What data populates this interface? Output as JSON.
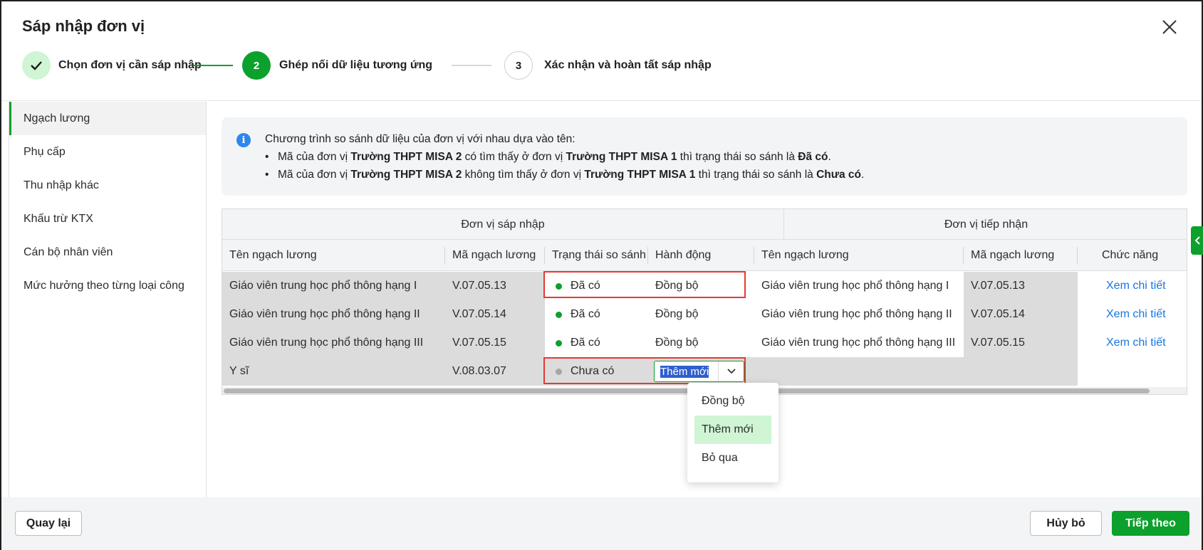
{
  "dialog": {
    "title": "Sáp nhập đơn vị"
  },
  "steps": [
    {
      "number": "",
      "label": "Chọn đơn vị cần sáp nhập",
      "state": "done"
    },
    {
      "number": "2",
      "label": "Ghép nối dữ liệu tương ứng",
      "state": "active"
    },
    {
      "number": "3",
      "label": "Xác nhận và hoàn tất sáp nhập",
      "state": "pending"
    }
  ],
  "sidebar": {
    "items": [
      {
        "label": "Ngạch lương",
        "active": true
      },
      {
        "label": "Phụ cấp"
      },
      {
        "label": "Thu nhập khác"
      },
      {
        "label": "Khấu trừ KTX"
      },
      {
        "label": "Cán bộ nhân viên"
      },
      {
        "label": "Mức hưởng theo từng loại công"
      }
    ]
  },
  "info": {
    "intro": "Chương trình so sánh dữ liệu của đơn vị với nhau dựa vào tên:",
    "line1": {
      "a": "Mã của đơn vị ",
      "b": "Trường THPT MISA 2",
      "c": " có tìm thấy ở đơn vị ",
      "d": "Trường THPT MISA 1",
      "e": " thì trạng thái so sánh là ",
      "f": "Đã có",
      "g": "."
    },
    "line2": {
      "a": "Mã của đơn vị ",
      "b": "Trường THPT MISA 2",
      "c": " không tìm thấy ở đơn vị ",
      "d": "Trường THPT MISA 1",
      "e": " thì trạng thái so sánh là ",
      "f": "Chưa có",
      "g": "."
    }
  },
  "table": {
    "group_left": "Đơn vị sáp nhập",
    "group_right": "Đơn vị tiếp nhận",
    "columns": {
      "src_name": "Tên ngạch lương",
      "src_code": "Mã ngạch lương",
      "status": "Trạng thái so sánh",
      "action": "Hành động",
      "dst_name": "Tên ngạch lương",
      "dst_code": "Mã ngạch lương",
      "func": "Chức năng"
    },
    "rows": [
      {
        "src_name": "Giáo viên trung học phổ thông hạng I",
        "src_code": "V.07.05.13",
        "status": "Đã có",
        "action": "Đồng bộ",
        "dst_name": "Giáo viên trung học phổ thông hạng I",
        "dst_code": "V.07.05.13",
        "func": "Xem chi tiết"
      },
      {
        "src_name": "Giáo viên trung học phổ thông hạng II",
        "src_code": "V.07.05.14",
        "status": "Đã có",
        "action": "Đồng bộ",
        "dst_name": "Giáo viên trung học phổ thông hạng II",
        "dst_code": "V.07.05.14",
        "func": "Xem chi tiết"
      },
      {
        "src_name": "Giáo viên trung học phổ thông hạng III",
        "src_code": "V.07.05.15",
        "status": "Đã có",
        "action": "Đồng bộ",
        "dst_name": "Giáo viên trung học phổ thông hạng III",
        "dst_code": "V.07.05.15",
        "func": "Xem chi tiết"
      },
      {
        "src_name": "Y sĩ",
        "src_code": "V.08.03.07",
        "status": "Chưa có",
        "action": "Thêm mới",
        "dst_name": "",
        "dst_code": "",
        "func": ""
      }
    ]
  },
  "dropdown": {
    "options": [
      "Đồng bộ",
      "Thêm mới",
      "Bỏ qua"
    ],
    "selected": "Thêm mới"
  },
  "footer": {
    "back": "Quay lại",
    "cancel": "Hủy bỏ",
    "next": "Tiếp theo"
  },
  "colors": {
    "primary_green": "#0ca02c",
    "status_found": "#0ca02c",
    "status_missing": "#a6a6a6",
    "link_blue": "#1876e0",
    "highlight_red": "#e53935"
  }
}
